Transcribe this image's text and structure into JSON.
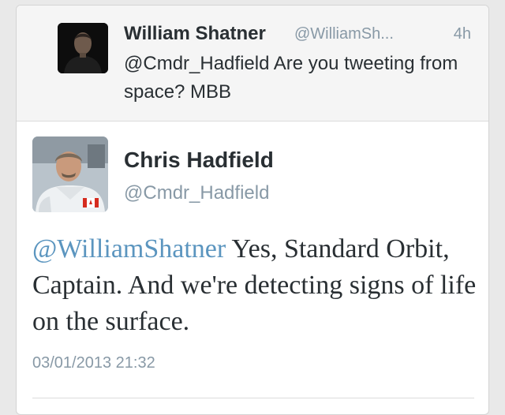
{
  "reply_tweet": {
    "name": "William Shatner",
    "handle": "@WilliamSh...",
    "time": "4h",
    "text": "@Cmdr_Hadfield Are you tweeting from space? MBB"
  },
  "main_tweet": {
    "name": "Chris Hadfield",
    "handle": "@Cmdr_Hadfield",
    "mention": "@WilliamShatner",
    "text": " Yes, Standard Orbit, Captain. And we're detecting signs of life on the surface.",
    "timestamp": "03/01/2013 21:32"
  },
  "colors": {
    "mention": "#5b95bf",
    "secondary_text": "#8899a6"
  }
}
